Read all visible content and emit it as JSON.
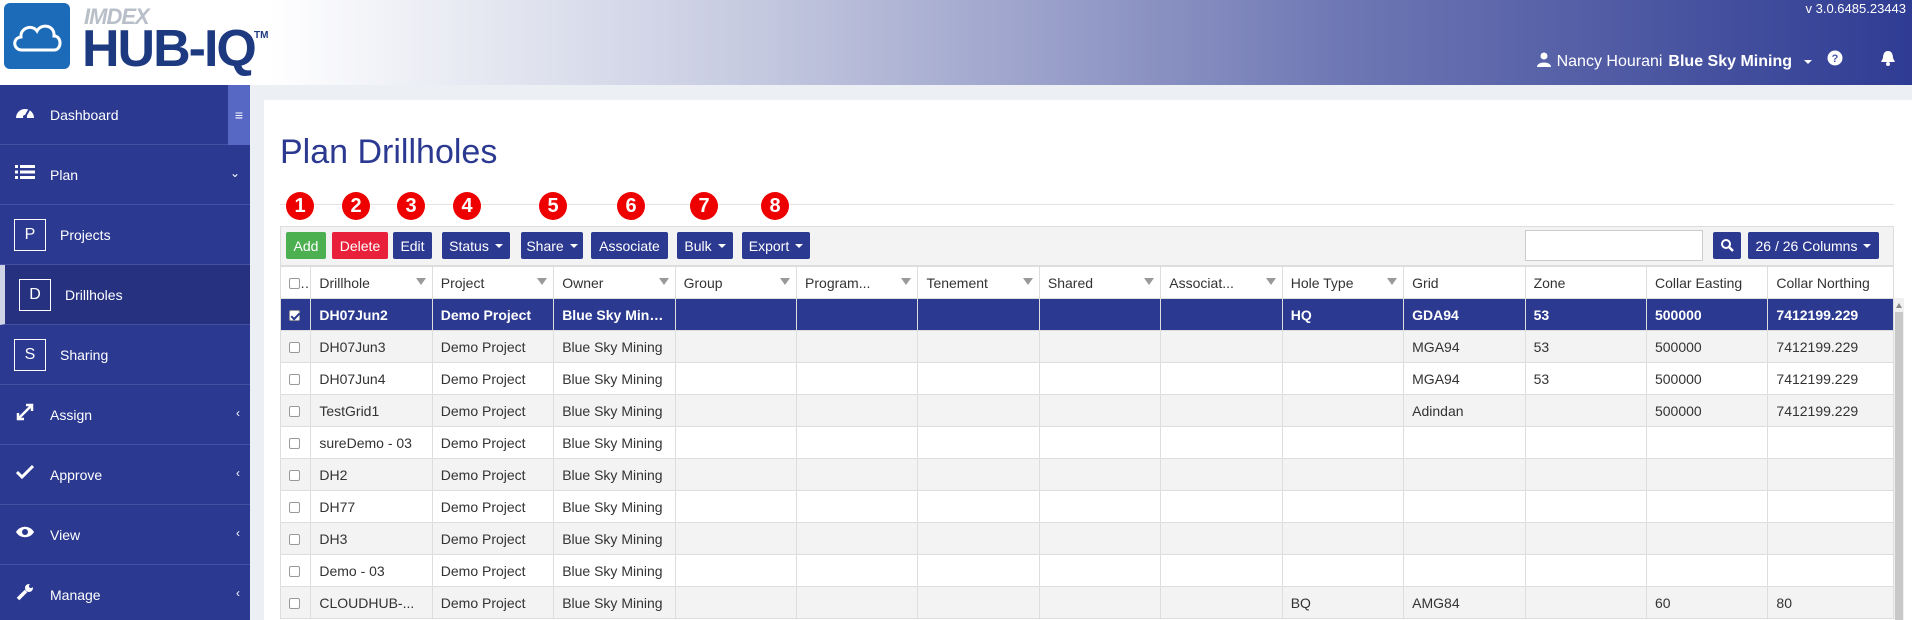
{
  "header": {
    "brand_small": "IMDEX",
    "brand_main": "HUB-IQ",
    "trademark": "TM",
    "version": "v 3.0.6485.23443",
    "user_name": "Nancy Hourani",
    "organization": "Blue Sky Mining",
    "icons": [
      "user-icon",
      "question-circle-icon",
      "bell-icon",
      "cloud-logo-icon"
    ]
  },
  "sidebar": {
    "items": [
      {
        "label": "Dashboard",
        "icon": "dashboard-icon"
      },
      {
        "label": "Plan",
        "icon": "list-icon"
      },
      {
        "label": "Projects",
        "letter": "P"
      },
      {
        "label": "Drillholes",
        "letter": "D"
      },
      {
        "label": "Sharing",
        "letter": "S"
      },
      {
        "label": "Assign",
        "icon": "expand-arrows-icon"
      },
      {
        "label": "Approve",
        "icon": "checkmark-icon"
      },
      {
        "label": "View",
        "icon": "eye-icon"
      },
      {
        "label": "Manage",
        "icon": "wrench-icon"
      }
    ]
  },
  "page": {
    "title": "Plan Drillholes"
  },
  "markers": [
    "1",
    "2",
    "3",
    "4",
    "5",
    "6",
    "7",
    "8"
  ],
  "toolbar": {
    "add": "Add",
    "delete": "Delete",
    "edit": "Edit",
    "status": "Status",
    "share": "Share",
    "associate": "Associate",
    "bulk": "Bulk",
    "export": "Export",
    "search_value": "",
    "columns": "26 / 26 Columns"
  },
  "table": {
    "columns": [
      "Drillhole",
      "Project",
      "Owner",
      "Group",
      "Program...",
      "Tenement",
      "Shared",
      "Associat...",
      "Hole Type",
      "Grid",
      "Zone",
      "Collar Easting",
      "Collar Northing"
    ],
    "rows": [
      {
        "checked": true,
        "cells": [
          "DH07Jun2",
          "Demo Project",
          "Blue Sky Mining",
          "",
          "",
          "",
          "",
          "",
          "HQ",
          "GDA94",
          "53",
          "500000",
          "7412199.229"
        ]
      },
      {
        "checked": false,
        "cells": [
          "DH07Jun3",
          "Demo Project",
          "Blue Sky Mining",
          "",
          "",
          "",
          "",
          "",
          "",
          "MGA94",
          "53",
          "500000",
          "7412199.229"
        ]
      },
      {
        "checked": false,
        "cells": [
          "DH07Jun4",
          "Demo Project",
          "Blue Sky Mining",
          "",
          "",
          "",
          "",
          "",
          "",
          "MGA94",
          "53",
          "500000",
          "7412199.229"
        ]
      },
      {
        "checked": false,
        "cells": [
          "TestGrid1",
          "Demo Project",
          "Blue Sky Mining",
          "",
          "",
          "",
          "",
          "",
          "",
          "Adindan",
          "",
          "500000",
          "7412199.229"
        ]
      },
      {
        "checked": false,
        "cells": [
          "sureDemo - 03",
          "Demo Project",
          "Blue Sky Mining",
          "",
          "",
          "",
          "",
          "",
          "",
          "",
          "",
          "",
          ""
        ]
      },
      {
        "checked": false,
        "cells": [
          "DH2",
          "Demo Project",
          "Blue Sky Mining",
          "",
          "",
          "",
          "",
          "",
          "",
          "",
          "",
          "",
          ""
        ]
      },
      {
        "checked": false,
        "cells": [
          "DH77",
          "Demo Project",
          "Blue Sky Mining",
          "",
          "",
          "",
          "",
          "",
          "",
          "",
          "",
          "",
          ""
        ]
      },
      {
        "checked": false,
        "cells": [
          "DH3",
          "Demo Project",
          "Blue Sky Mining",
          "",
          "",
          "",
          "",
          "",
          "",
          "",
          "",
          "",
          ""
        ]
      },
      {
        "checked": false,
        "cells": [
          "Demo - 03",
          "Demo Project",
          "Blue Sky Mining",
          "",
          "",
          "",
          "",
          "",
          "",
          "",
          "",
          "",
          ""
        ]
      },
      {
        "checked": false,
        "cells": [
          "CLOUDHUB-...",
          "Demo Project",
          "Blue Sky Mining",
          "",
          "",
          "",
          "",
          "",
          "BQ",
          "AMG84",
          "",
          "60",
          "80"
        ]
      }
    ]
  },
  "colors": {
    "primary": "#2b3990",
    "add": "#4caf50",
    "delete": "#e8203a",
    "marker": "#ee0000"
  }
}
